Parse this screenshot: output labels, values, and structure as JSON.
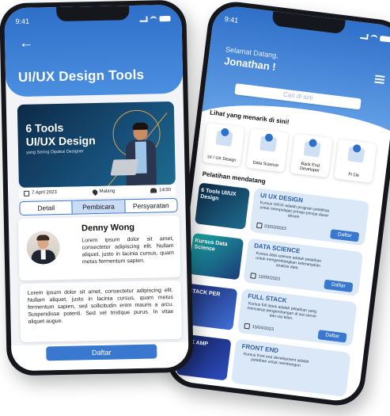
{
  "detail_screen": {
    "status_time": "9:41",
    "page_title": "UI/UX Design Tools",
    "banner": {
      "line1": "6 Tools",
      "line2": "UI/UX Design",
      "line3": "yang Sering Dipakai Designer"
    },
    "meta": {
      "date": "7 April 2023",
      "location": "Malang",
      "quota": "14/30"
    },
    "tabs": [
      {
        "label": "Detail",
        "active": false
      },
      {
        "label": "Pembicara",
        "active": true
      },
      {
        "label": "Persyaratan",
        "active": false
      }
    ],
    "speaker": {
      "name": "Denny Wong",
      "bio": "Lorem ipsum dolor sit amet, consectetur adipiscing elit. Nullam aliquet, justo in lacinia cursus, quam metus fermentum sapien."
    },
    "description": "Lorem ipsum dolor sit amet, consectetur adipiscing elit. Nullam aliquet, justo in lacinia cursus, quam metus fermentum sapien, sed sollicitudin enim mauris a arcu. Suspendisse potenti. Sed vel tristique purus. In vitae aliquet augue.",
    "register_button": "Daftar"
  },
  "home_screen": {
    "status_time": "9:41",
    "greeting": "Selamat Datang,",
    "user_name": "Jonathan !",
    "search_placeholder": "Cari di sini",
    "interests_title": "Lihat yang menarik di sini!",
    "categories": [
      {
        "label": "UI / UX Design"
      },
      {
        "label": "Data Science"
      },
      {
        "label": "Back End Developer"
      },
      {
        "label": "Fr De"
      }
    ],
    "upcoming_title": "Pelatihan mendatang",
    "events": [
      {
        "thumb": "6 Tools UI/UX Design",
        "title": "UI UX DESIGN",
        "desc": "Kursus UI/UX adalah program pelatihan untuk mempelajari prinsip-prinsip dasar desain",
        "date": "03/03/2023",
        "button": "Daftar"
      },
      {
        "thumb": "Kursus Data Science",
        "title": "DATA SCIENCE",
        "desc": "Kursus data science adalah pelatihan untuk mengembangkan keterampilan analisis data.",
        "date": "12/05/2023",
        "button": "Daftar"
      },
      {
        "thumb": "STACK PER",
        "title": "FULL STACK",
        "desc": "Kursus full stack adalah pelatihan yang mencakup pengembangan di sisi server dan sisi klien.",
        "date": "15/04/2023",
        "button": "Daftar"
      },
      {
        "thumb": "ACK AMP",
        "title": "FRONT END",
        "desc": "Kursus front end development adalah pelatihan untuk membangun",
        "date": "",
        "button": ""
      }
    ]
  },
  "colors": {
    "primary": "#3a78cf",
    "header_gradient_start": "#2e6fc9",
    "card_bg": "#dbe8f8",
    "banner_bg": "#0d2a47"
  }
}
